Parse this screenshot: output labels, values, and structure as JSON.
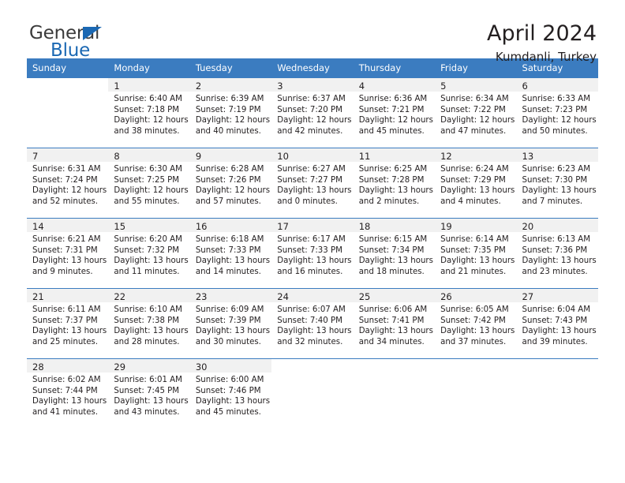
{
  "brand": {
    "name_part1": "General",
    "name_part2": "Blue",
    "accent_color": "#1b68b3",
    "triangle_icon": "triangle-icon"
  },
  "header": {
    "title": "April 2024",
    "location": "Kumdanli, Turkey"
  },
  "calendar": {
    "header_bg": "#3b7cc0",
    "daynum_bg": "#f1f1f1",
    "weekdays": [
      "Sunday",
      "Monday",
      "Tuesday",
      "Wednesday",
      "Thursday",
      "Friday",
      "Saturday"
    ],
    "weeks": [
      [
        {
          "day": "",
          "sunrise": "",
          "sunset": "",
          "daylight1": "",
          "daylight2": ""
        },
        {
          "day": "1",
          "sunrise": "Sunrise: 6:40 AM",
          "sunset": "Sunset: 7:18 PM",
          "daylight1": "Daylight: 12 hours",
          "daylight2": "and 38 minutes."
        },
        {
          "day": "2",
          "sunrise": "Sunrise: 6:39 AM",
          "sunset": "Sunset: 7:19 PM",
          "daylight1": "Daylight: 12 hours",
          "daylight2": "and 40 minutes."
        },
        {
          "day": "3",
          "sunrise": "Sunrise: 6:37 AM",
          "sunset": "Sunset: 7:20 PM",
          "daylight1": "Daylight: 12 hours",
          "daylight2": "and 42 minutes."
        },
        {
          "day": "4",
          "sunrise": "Sunrise: 6:36 AM",
          "sunset": "Sunset: 7:21 PM",
          "daylight1": "Daylight: 12 hours",
          "daylight2": "and 45 minutes."
        },
        {
          "day": "5",
          "sunrise": "Sunrise: 6:34 AM",
          "sunset": "Sunset: 7:22 PM",
          "daylight1": "Daylight: 12 hours",
          "daylight2": "and 47 minutes."
        },
        {
          "day": "6",
          "sunrise": "Sunrise: 6:33 AM",
          "sunset": "Sunset: 7:23 PM",
          "daylight1": "Daylight: 12 hours",
          "daylight2": "and 50 minutes."
        }
      ],
      [
        {
          "day": "7",
          "sunrise": "Sunrise: 6:31 AM",
          "sunset": "Sunset: 7:24 PM",
          "daylight1": "Daylight: 12 hours",
          "daylight2": "and 52 minutes."
        },
        {
          "day": "8",
          "sunrise": "Sunrise: 6:30 AM",
          "sunset": "Sunset: 7:25 PM",
          "daylight1": "Daylight: 12 hours",
          "daylight2": "and 55 minutes."
        },
        {
          "day": "9",
          "sunrise": "Sunrise: 6:28 AM",
          "sunset": "Sunset: 7:26 PM",
          "daylight1": "Daylight: 12 hours",
          "daylight2": "and 57 minutes."
        },
        {
          "day": "10",
          "sunrise": "Sunrise: 6:27 AM",
          "sunset": "Sunset: 7:27 PM",
          "daylight1": "Daylight: 13 hours",
          "daylight2": "and 0 minutes."
        },
        {
          "day": "11",
          "sunrise": "Sunrise: 6:25 AM",
          "sunset": "Sunset: 7:28 PM",
          "daylight1": "Daylight: 13 hours",
          "daylight2": "and 2 minutes."
        },
        {
          "day": "12",
          "sunrise": "Sunrise: 6:24 AM",
          "sunset": "Sunset: 7:29 PM",
          "daylight1": "Daylight: 13 hours",
          "daylight2": "and 4 minutes."
        },
        {
          "day": "13",
          "sunrise": "Sunrise: 6:23 AM",
          "sunset": "Sunset: 7:30 PM",
          "daylight1": "Daylight: 13 hours",
          "daylight2": "and 7 minutes."
        }
      ],
      [
        {
          "day": "14",
          "sunrise": "Sunrise: 6:21 AM",
          "sunset": "Sunset: 7:31 PM",
          "daylight1": "Daylight: 13 hours",
          "daylight2": "and 9 minutes."
        },
        {
          "day": "15",
          "sunrise": "Sunrise: 6:20 AM",
          "sunset": "Sunset: 7:32 PM",
          "daylight1": "Daylight: 13 hours",
          "daylight2": "and 11 minutes."
        },
        {
          "day": "16",
          "sunrise": "Sunrise: 6:18 AM",
          "sunset": "Sunset: 7:33 PM",
          "daylight1": "Daylight: 13 hours",
          "daylight2": "and 14 minutes."
        },
        {
          "day": "17",
          "sunrise": "Sunrise: 6:17 AM",
          "sunset": "Sunset: 7:33 PM",
          "daylight1": "Daylight: 13 hours",
          "daylight2": "and 16 minutes."
        },
        {
          "day": "18",
          "sunrise": "Sunrise: 6:15 AM",
          "sunset": "Sunset: 7:34 PM",
          "daylight1": "Daylight: 13 hours",
          "daylight2": "and 18 minutes."
        },
        {
          "day": "19",
          "sunrise": "Sunrise: 6:14 AM",
          "sunset": "Sunset: 7:35 PM",
          "daylight1": "Daylight: 13 hours",
          "daylight2": "and 21 minutes."
        },
        {
          "day": "20",
          "sunrise": "Sunrise: 6:13 AM",
          "sunset": "Sunset: 7:36 PM",
          "daylight1": "Daylight: 13 hours",
          "daylight2": "and 23 minutes."
        }
      ],
      [
        {
          "day": "21",
          "sunrise": "Sunrise: 6:11 AM",
          "sunset": "Sunset: 7:37 PM",
          "daylight1": "Daylight: 13 hours",
          "daylight2": "and 25 minutes."
        },
        {
          "day": "22",
          "sunrise": "Sunrise: 6:10 AM",
          "sunset": "Sunset: 7:38 PM",
          "daylight1": "Daylight: 13 hours",
          "daylight2": "and 28 minutes."
        },
        {
          "day": "23",
          "sunrise": "Sunrise: 6:09 AM",
          "sunset": "Sunset: 7:39 PM",
          "daylight1": "Daylight: 13 hours",
          "daylight2": "and 30 minutes."
        },
        {
          "day": "24",
          "sunrise": "Sunrise: 6:07 AM",
          "sunset": "Sunset: 7:40 PM",
          "daylight1": "Daylight: 13 hours",
          "daylight2": "and 32 minutes."
        },
        {
          "day": "25",
          "sunrise": "Sunrise: 6:06 AM",
          "sunset": "Sunset: 7:41 PM",
          "daylight1": "Daylight: 13 hours",
          "daylight2": "and 34 minutes."
        },
        {
          "day": "26",
          "sunrise": "Sunrise: 6:05 AM",
          "sunset": "Sunset: 7:42 PM",
          "daylight1": "Daylight: 13 hours",
          "daylight2": "and 37 minutes."
        },
        {
          "day": "27",
          "sunrise": "Sunrise: 6:04 AM",
          "sunset": "Sunset: 7:43 PM",
          "daylight1": "Daylight: 13 hours",
          "daylight2": "and 39 minutes."
        }
      ],
      [
        {
          "day": "28",
          "sunrise": "Sunrise: 6:02 AM",
          "sunset": "Sunset: 7:44 PM",
          "daylight1": "Daylight: 13 hours",
          "daylight2": "and 41 minutes."
        },
        {
          "day": "29",
          "sunrise": "Sunrise: 6:01 AM",
          "sunset": "Sunset: 7:45 PM",
          "daylight1": "Daylight: 13 hours",
          "daylight2": "and 43 minutes."
        },
        {
          "day": "30",
          "sunrise": "Sunrise: 6:00 AM",
          "sunset": "Sunset: 7:46 PM",
          "daylight1": "Daylight: 13 hours",
          "daylight2": "and 45 minutes."
        },
        {
          "day": "",
          "sunrise": "",
          "sunset": "",
          "daylight1": "",
          "daylight2": ""
        },
        {
          "day": "",
          "sunrise": "",
          "sunset": "",
          "daylight1": "",
          "daylight2": ""
        },
        {
          "day": "",
          "sunrise": "",
          "sunset": "",
          "daylight1": "",
          "daylight2": ""
        },
        {
          "day": "",
          "sunrise": "",
          "sunset": "",
          "daylight1": "",
          "daylight2": ""
        }
      ]
    ]
  }
}
